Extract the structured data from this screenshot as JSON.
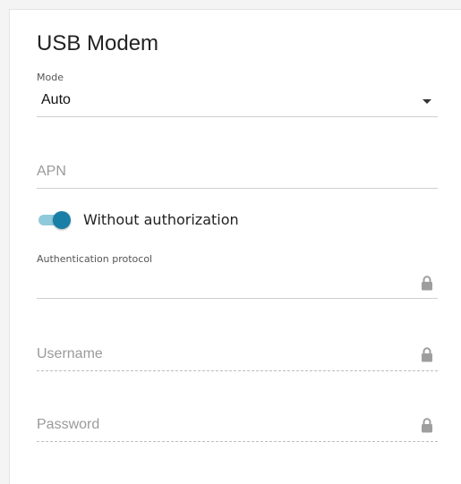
{
  "card": {
    "title": "USB Modem"
  },
  "mode": {
    "label": "Mode",
    "value": "Auto"
  },
  "apn": {
    "placeholder": "APN",
    "value": ""
  },
  "auth_toggle": {
    "label": "Without authorization",
    "state": "on",
    "accent_color": "#1a7fa6"
  },
  "auth_protocol": {
    "label": "Authentication protocol",
    "value": "",
    "icon": "lock-icon"
  },
  "username": {
    "placeholder": "Username",
    "value": "",
    "icon": "lock-icon"
  },
  "password": {
    "placeholder": "Password",
    "value": "",
    "icon": "lock-icon"
  }
}
